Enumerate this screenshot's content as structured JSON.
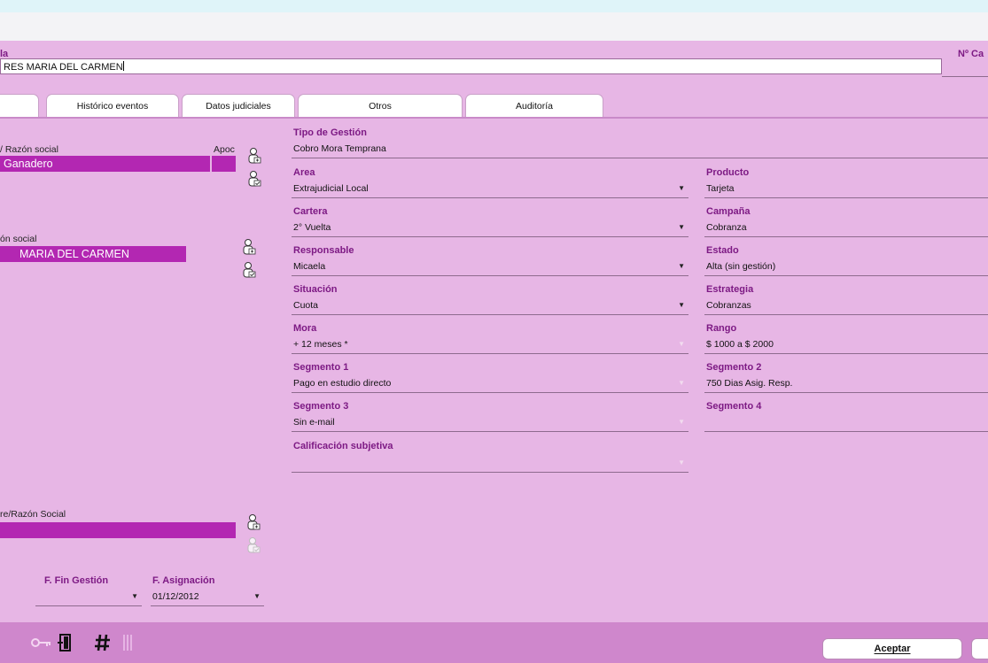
{
  "header": {
    "title_label": "la",
    "name_value": "RES MARIA DEL CARMEN",
    "right_label": "Nº Ca"
  },
  "tabs": [
    {
      "label": ""
    },
    {
      "label": "Histórico eventos"
    },
    {
      "label": "Datos judiciales"
    },
    {
      "label": "Otros"
    },
    {
      "label": "Auditoría"
    }
  ],
  "left": {
    "razon_label": "/ Razón social",
    "apoc_label": "Apoc",
    "razon_value": "Ganadero",
    "razon2_label": "ón social",
    "razon2_value": "MARIA DEL CARMEN",
    "nombre_label": "re/Razón Social",
    "nombre_value": "",
    "fin_gestion_label": "F. Fin Gestión",
    "fin_gestion_value": "",
    "asignacion_label": "F. Asignación",
    "asignacion_value": "01/12/2012"
  },
  "center": {
    "tipo_gestion": {
      "label": "Tipo de Gestión",
      "value": "Cobro Mora Temprana"
    },
    "area": {
      "label": "Area",
      "value": "Extrajudicial Local"
    },
    "cartera": {
      "label": "Cartera",
      "value": "2° Vuelta"
    },
    "responsable": {
      "label": "Responsable",
      "value": "Micaela"
    },
    "situacion": {
      "label": "Situación",
      "value": "Cuota"
    },
    "mora": {
      "label": "Mora",
      "value": "+ 12 meses *"
    },
    "segmento1": {
      "label": "Segmento 1",
      "value": "Pago en estudio directo"
    },
    "segmento3": {
      "label": "Segmento 3",
      "value": "Sin e-mail"
    },
    "calificacion": {
      "label": "Calificación subjetiva",
      "value": ""
    }
  },
  "right": {
    "producto": {
      "label": "Producto",
      "value": "Tarjeta"
    },
    "campana": {
      "label": "Campaña",
      "value": "Cobranza"
    },
    "estado": {
      "label": "Estado",
      "value": "Alta (sin gestión)"
    },
    "estrategia": {
      "label": "Estrategia",
      "value": "Cobranzas"
    },
    "rango": {
      "label": "Rango",
      "value": "$ 1000 a $ 2000"
    },
    "segmento2": {
      "label": "Segmento 2",
      "value": "750 Dias Asig. Resp."
    },
    "segmento4": {
      "label": "Segmento 4",
      "value": ""
    }
  },
  "buttons": {
    "aceptar": "Aceptar",
    "second": ""
  },
  "icons": {
    "person_add": "person-add-icon",
    "person_check": "person-check-icon",
    "toolbar_key": "key-icon",
    "toolbar_door": "door-icon",
    "toolbar_hash": "hash-icon",
    "toolbar_bars": "bars-icon"
  },
  "colors": {
    "panel_bg": "#e7b6e5",
    "accent_label": "#7d1a84",
    "selection": "#b327b2",
    "bottom_bar": "#cf87cc"
  }
}
